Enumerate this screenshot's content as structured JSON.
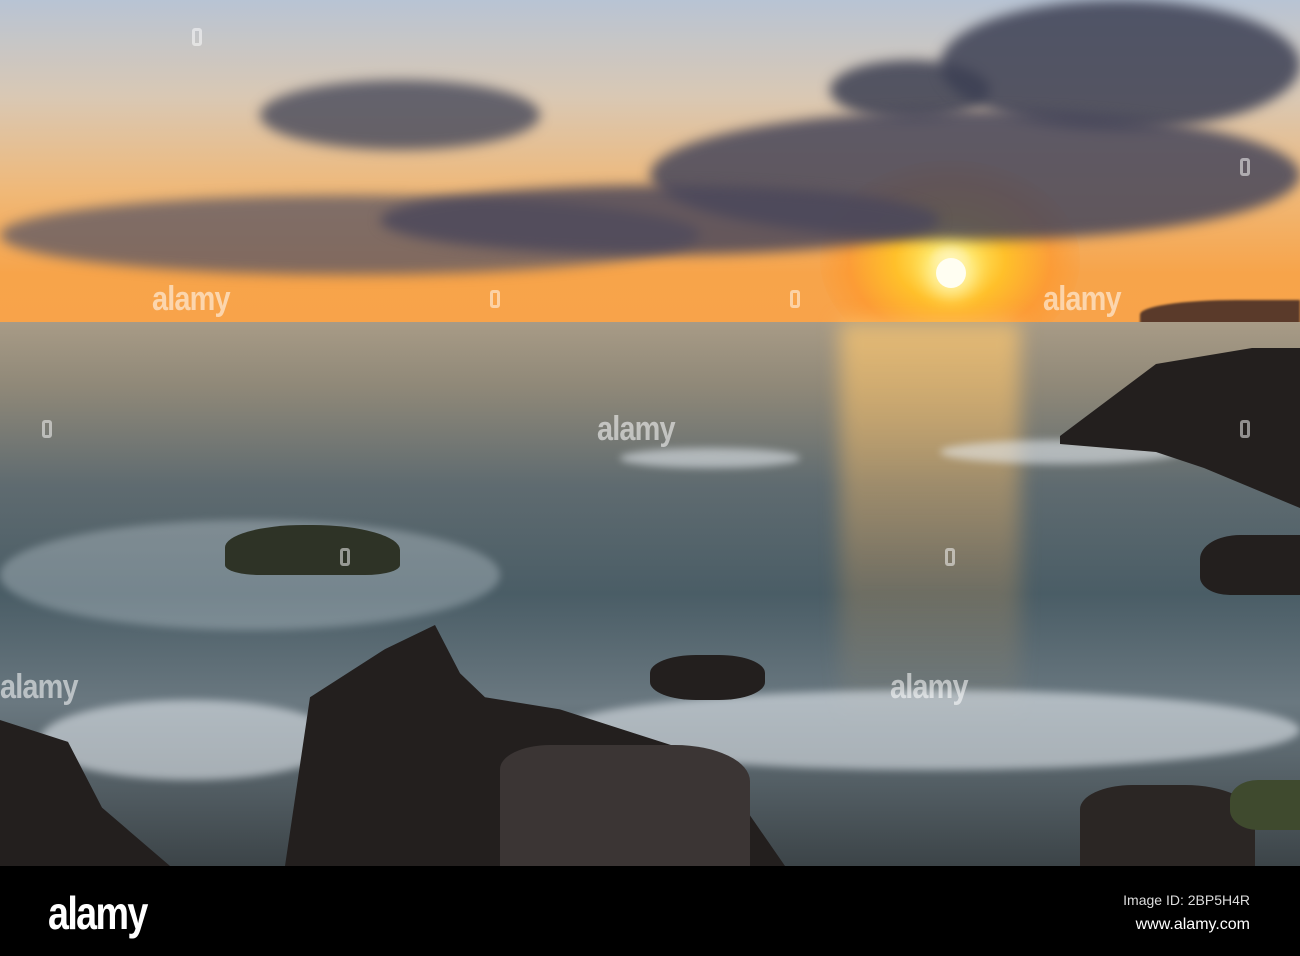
{
  "watermark": "alamy",
  "footer": {
    "logo": "alamy",
    "image_id": "Image ID: 2BP5H4R",
    "url": "www.alamy.com"
  }
}
